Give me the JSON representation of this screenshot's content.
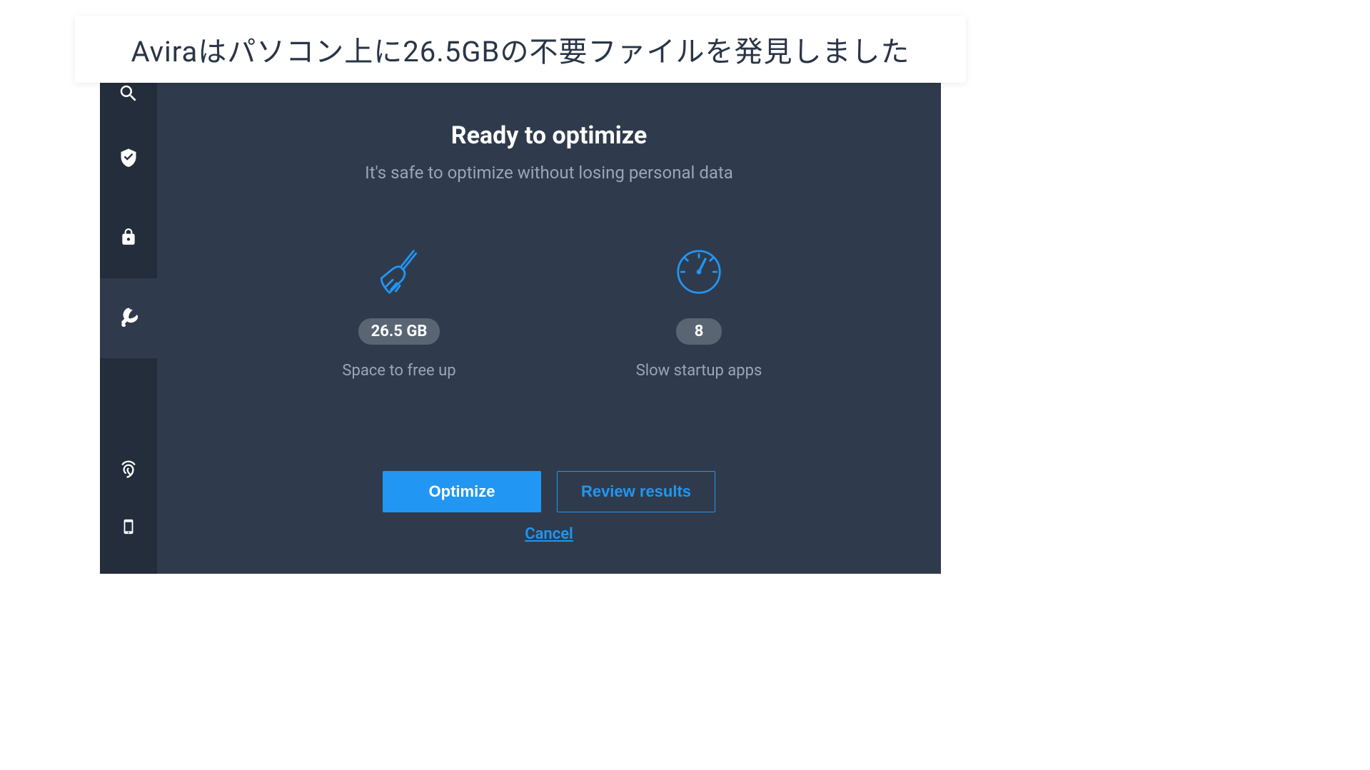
{
  "banner": {
    "text": "Aviraはパソコン上に26.5GBの不要ファイルを発見しました"
  },
  "main": {
    "title": "Ready to optimize",
    "subtitle": "It's safe to optimize without losing personal data",
    "metrics": {
      "space": {
        "value": "26.5 GB",
        "label": "Space to free up"
      },
      "startup": {
        "value": "8",
        "label": "Slow startup apps"
      }
    },
    "actions": {
      "optimize": "Optimize",
      "review": "Review results",
      "cancel": "Cancel"
    }
  },
  "colors": {
    "accent": "#2196f3",
    "bg_dark": "#2f3b4c",
    "sidebar": "#232d3b"
  }
}
